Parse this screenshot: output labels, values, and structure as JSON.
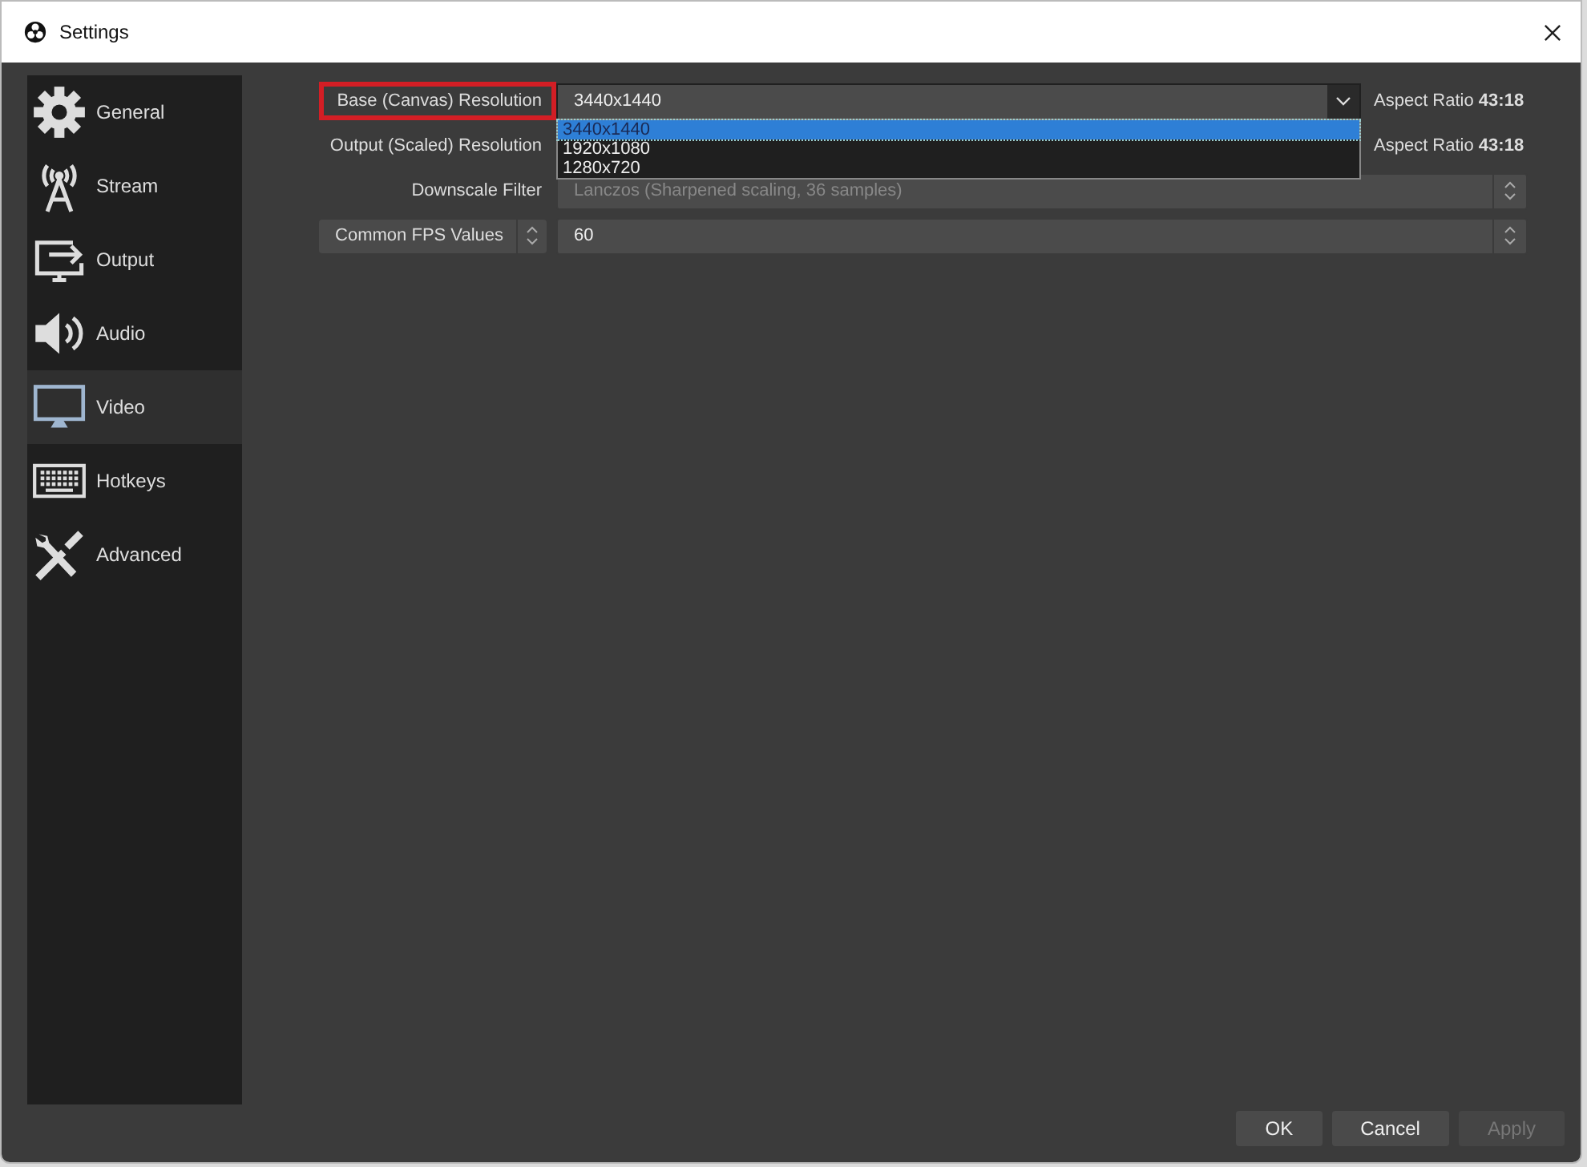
{
  "window": {
    "title": "Settings"
  },
  "sidebar": {
    "items": [
      {
        "label": "General",
        "selected": false
      },
      {
        "label": "Stream",
        "selected": false
      },
      {
        "label": "Output",
        "selected": false
      },
      {
        "label": "Audio",
        "selected": false
      },
      {
        "label": "Video",
        "selected": true
      },
      {
        "label": "Hotkeys",
        "selected": false
      },
      {
        "label": "Advanced",
        "selected": false
      }
    ]
  },
  "form": {
    "rows": [
      {
        "kind": "editable",
        "label": "Base (Canvas) Resolution",
        "highlighted": true,
        "value": "3440x1440",
        "aspect_label": "Aspect Ratio",
        "aspect_value": "43:18"
      },
      {
        "kind": "editable",
        "label": "Output (Scaled) Resolution",
        "aspect_label": "Aspect Ratio",
        "aspect_value": "43:18"
      },
      {
        "kind": "spin",
        "label": "Downscale Filter",
        "value": "Lanczos (Sharpened scaling, 36 samples)"
      },
      {
        "kind": "spin-button",
        "label": "Common FPS Values",
        "value": "60"
      }
    ]
  },
  "dropdown": {
    "items": [
      {
        "label": "3440x1440",
        "selected": true
      },
      {
        "label": "1920x1080",
        "selected": false
      },
      {
        "label": "1280x720",
        "selected": false
      }
    ]
  },
  "buttons": [
    {
      "label": "OK",
      "disabled": false
    },
    {
      "label": "Cancel",
      "disabled": false
    },
    {
      "label": "Apply",
      "disabled": true
    }
  ]
}
